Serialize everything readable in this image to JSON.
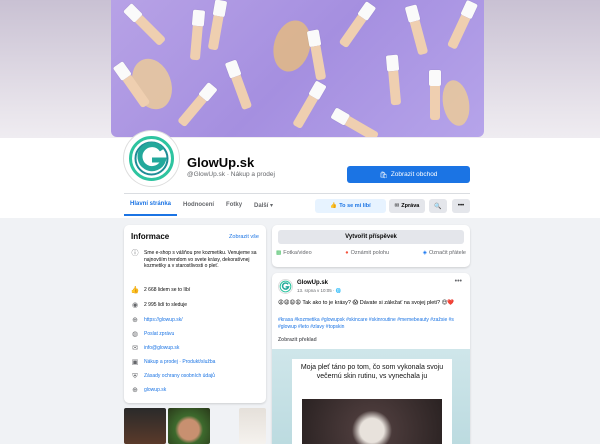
{
  "page": {
    "name": "GlowUp.sk",
    "subtitle": "@GlowUp.sk · Nákup a prodej",
    "shop_button": "Zobrazit obchod"
  },
  "tabs": [
    {
      "label": "Hlavní stránka",
      "active": true
    },
    {
      "label": "Hodnocení",
      "active": false
    },
    {
      "label": "Fotky",
      "active": false
    },
    {
      "label": "Další ▾",
      "active": false
    }
  ],
  "actions": {
    "like": "To se mi líbí",
    "message": "Zpráva",
    "search_icon": "search-icon",
    "more_icon": "more-icon"
  },
  "info": {
    "title": "Informace",
    "edit": "Zobrazit vše",
    "about": "Sme e-shop s vášňou pre kozmetiku. Venujeme sa najnovším trendom vo svete krásy, dekoratívnej kozmetiky a v starostlivosti o pleť.",
    "likes": "2 668 lidem se to líbí",
    "followers": "2 995 lidí to sleduje",
    "website": "https://glowup.sk/",
    "message": "Poslat zprávu",
    "email": "info@glowup.sk",
    "category": "Nákup a prodej · Produkt/služba",
    "privacy": "Zásady ochrany osobních údajů",
    "domain": "glowup.sk"
  },
  "composer": {
    "create": "Vytvořit příspěvek",
    "photo": "Fotka/video",
    "location": "Oznámit polohu",
    "tag": "Označit přátele"
  },
  "post": {
    "author": "GlowUp.sk",
    "time": "13. srpna v 10:05 · 🌐",
    "text": "😩😩😩😩 Tak ako to je krásy? 😱 Dávate si záležať na svojej pleti? 😍❤️",
    "tags": "#krasa #kozmetika #glowupsk #skincare #skinroutine #memebeauty #zažsie #s #glowup #leto #zlavy #topskin",
    "translate": "Zobrazit překlad",
    "image_text": "Moja pleť táno po tom, čo som vykonala svoju večernú skin rutinu, vs vynechala ju"
  },
  "colors": {
    "accent": "#1b74e4",
    "logo_green": "#2ec4a0",
    "logo_teal": "#1e8c96"
  }
}
